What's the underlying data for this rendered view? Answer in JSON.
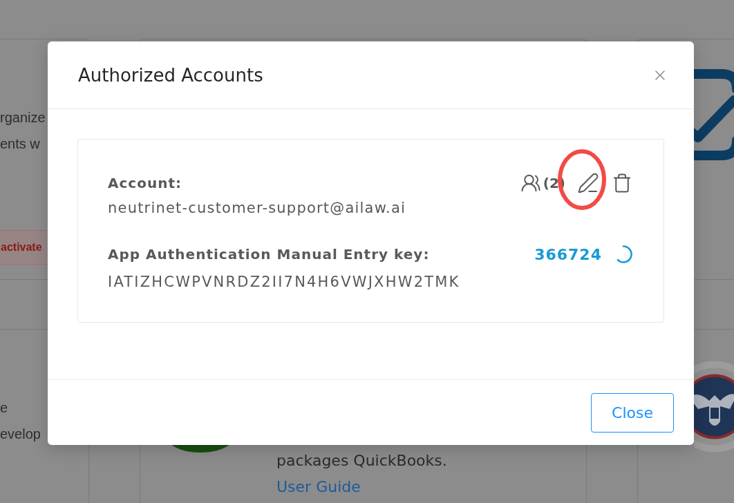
{
  "background": {
    "left_card": {
      "lines": [
        "rganize",
        "ents w"
      ],
      "status_badge": "activate",
      "lower_lines": [
        "e",
        "evelop"
      ]
    },
    "middle_card": {
      "description": "packages QuickBooks.",
      "link": "User Guide"
    }
  },
  "dialog": {
    "title": "Authorized Accounts",
    "accounts": [
      {
        "account_label": "Account:",
        "account": "neutrinet-customer-support@ailaw.ai",
        "key_label": "App Authentication Manual Entry key:",
        "key": "IATIZHCWPVNRDZ2II7N4H6VWJXHW2TMK",
        "actions": [
          {
            "kind": "members",
            "label": "(2)",
            "highlighted": false
          },
          {
            "kind": "edit",
            "highlighted": true
          },
          {
            "kind": "delete",
            "highlighted": false
          }
        ],
        "code": "366724"
      }
    ],
    "buttons": [
      "Close"
    ]
  }
}
